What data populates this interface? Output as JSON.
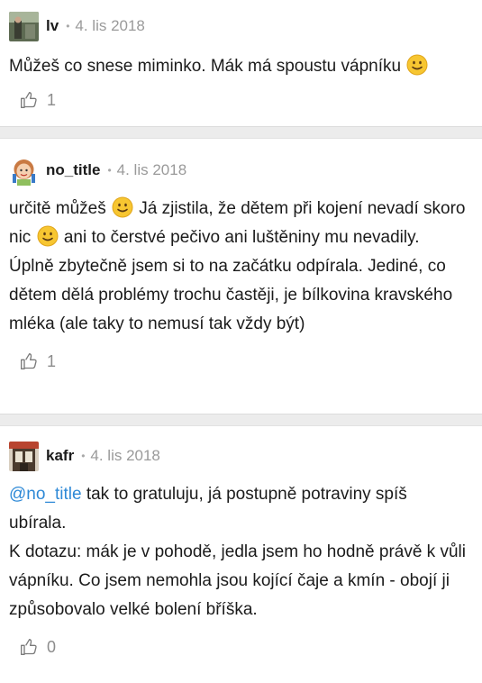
{
  "comments": [
    {
      "author": "lv",
      "separator": "•",
      "date": "4. lis 2018",
      "text": "Můžeš co snese miminko. Mák má spoustu vápníku",
      "emoji": "smile-emoji",
      "likes": "1"
    },
    {
      "author": "no_title",
      "separator": "•",
      "date": "4. lis 2018",
      "text_part1": "určitě můžeš",
      "text_part2": " Já zjistila, že dětem při kojení nevadí skoro nic",
      "text_part3": " ani to čerstvé pečivo ani luštěniny mu nevadily. Úplně zbytečně jsem si to na začátku odpírala. Jediné, co dětem dělá problémy trochu častěji, je bílkovina kravského mléka (ale taky to nemusí tak vždy být)",
      "likes": "1"
    },
    {
      "author": "kafr",
      "separator": "•",
      "date": "4. lis 2018",
      "mention": "@no_title",
      "text_part1": " tak to gratuluju, já postupně potraviny spíš ubírala.",
      "text_part2": "K dotazu: mák je v pohodě, jedla jsem ho hodně právě k vůli vápníku. Co jsem nemohla jsou kojící čaje a kmín - obojí ji způsobovalo velké bolení bříška.",
      "likes": "0"
    }
  ],
  "icons": {
    "like": "thumbs-up-icon",
    "emoji": "smiley-emoji"
  },
  "colors": {
    "mention": "#2e89d6",
    "meta": "#9a9a9a",
    "separator_bg": "#ececec",
    "emoji": "#f7c631"
  }
}
